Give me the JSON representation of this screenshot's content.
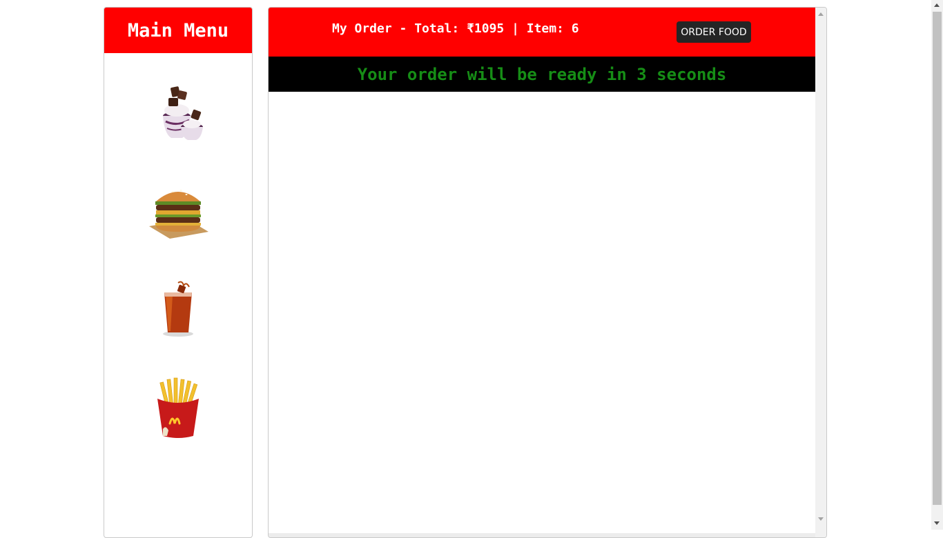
{
  "sidebar": {
    "title": "Main Menu",
    "items": [
      {
        "icon": "sundae-icon"
      },
      {
        "icon": "burger-icon"
      },
      {
        "icon": "cola-drink-icon"
      },
      {
        "icon": "fries-icon"
      }
    ]
  },
  "order": {
    "summary": "My Order - Total: ₹1095 | Item: 6",
    "button_label": "ORDER FOOD",
    "status": "Your order will be ready in 3 seconds"
  },
  "colors": {
    "accent": "#ff0000",
    "status_bg": "#000000",
    "status_text": "#168d16",
    "button_bg": "#252525"
  }
}
